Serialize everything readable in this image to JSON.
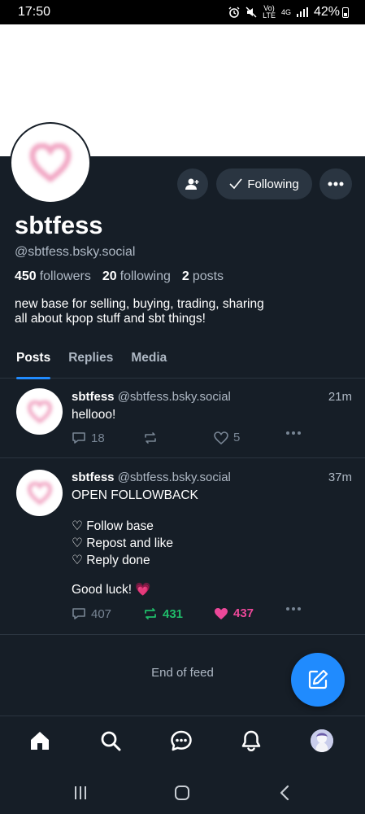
{
  "status_bar": {
    "time": "17:50",
    "volte_top": "Vo)",
    "volte_bottom": "LTE",
    "network": "4G",
    "battery": "42%"
  },
  "profile": {
    "display_name": "sbtfess",
    "handle": "@sbtfess.bsky.social",
    "followers_count": "450",
    "followers_label": "followers",
    "following_count": "20",
    "following_label": "following",
    "posts_count": "2",
    "posts_label": "posts",
    "bio_line1": "new base for selling, buying, trading, sharing",
    "bio_line2": "all about kpop stuff and sbt things!",
    "following_button": "Following"
  },
  "tabs": [
    {
      "label": "Posts",
      "active": true
    },
    {
      "label": "Replies",
      "active": false
    },
    {
      "label": "Media",
      "active": false
    }
  ],
  "posts": [
    {
      "name": "sbtfess",
      "handle": "@sbtfess.bsky.social",
      "time": "21m",
      "lines": [
        "hellooo!"
      ],
      "replies": "18",
      "reposts": "",
      "likes": "5"
    },
    {
      "name": "sbtfess",
      "handle": "@sbtfess.bsky.social",
      "time": "37m",
      "lines": [
        "OPEN FOLLOWBACK",
        "♡ Follow base",
        "♡ Repost and like",
        "♡ Reply done",
        "Good luck! 💗"
      ],
      "replies": "407",
      "reposts": "431",
      "likes": "437"
    }
  ],
  "feed_end": "End of feed",
  "colors": {
    "background": "#161e27",
    "accent": "#208bfe",
    "repost_active": "#20bc6a",
    "like_active": "#ec4899",
    "avatar_heart": "#f1a7c4"
  },
  "icons": {
    "nav": [
      "home-icon",
      "search-icon",
      "chat-icon",
      "bell-icon",
      "profile-avatar"
    ],
    "fab": "compose-icon",
    "system": [
      "recents-icon",
      "home-circle-icon",
      "back-icon"
    ]
  }
}
